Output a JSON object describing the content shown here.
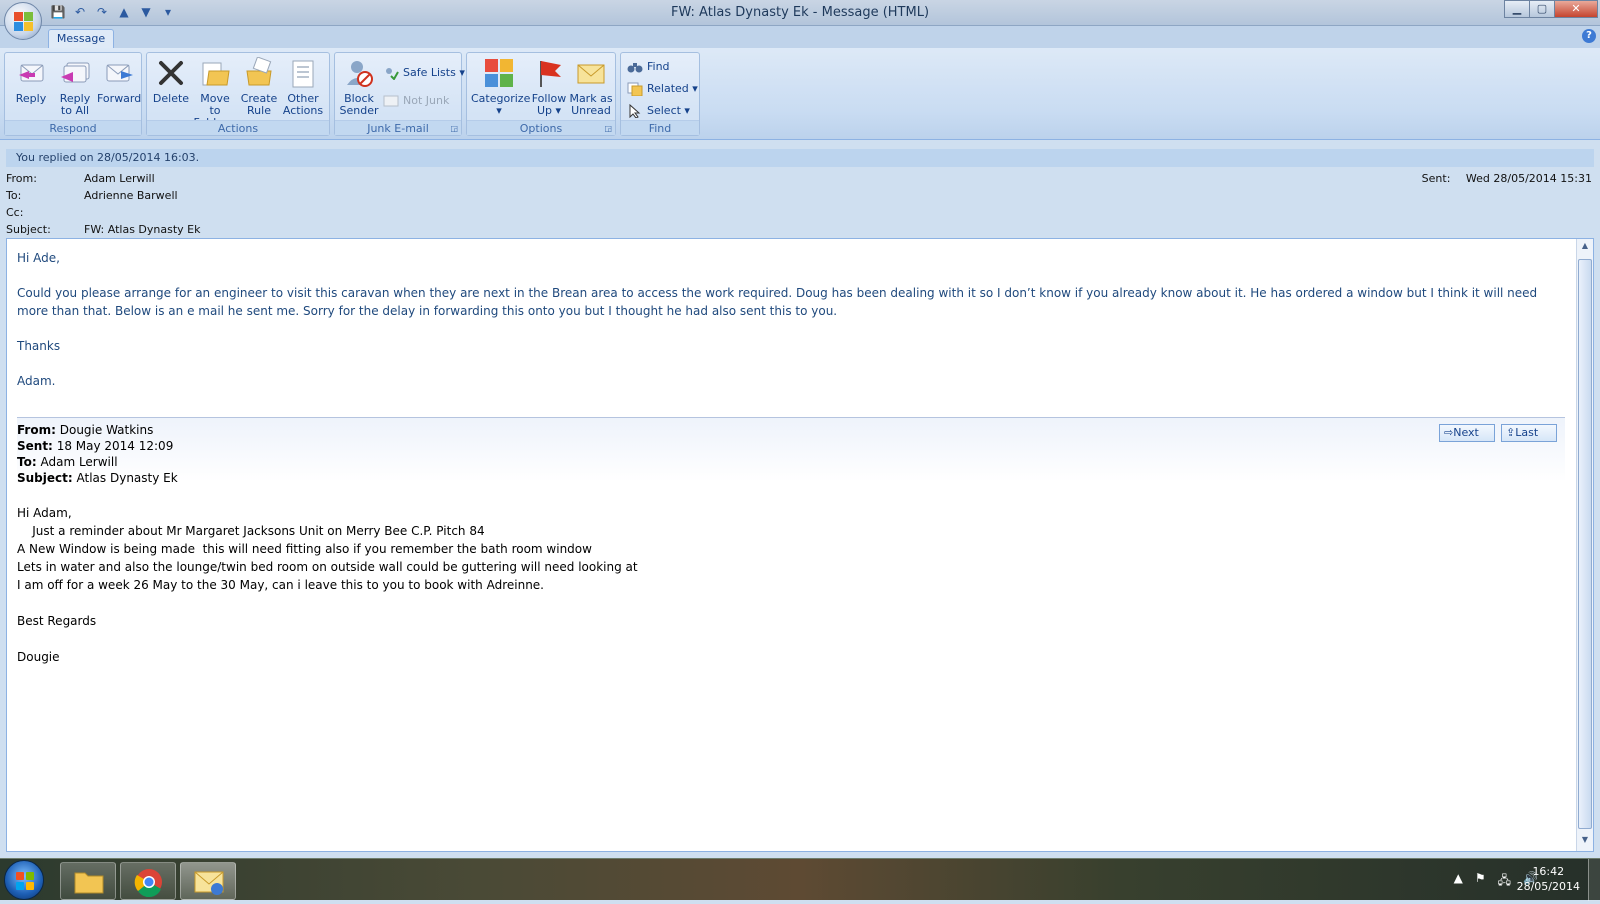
{
  "window": {
    "title": "FW: Atlas Dynasty Ek - Message (HTML)",
    "minimize": "▁",
    "maximize": "▢",
    "close": "✕"
  },
  "ribbon": {
    "tab_label": "Message",
    "groups": {
      "respond": {
        "label": "Respond",
        "reply": "Reply",
        "reply_all_1": "Reply",
        "reply_all_2": "to All",
        "forward": "Forward"
      },
      "actions": {
        "label": "Actions",
        "delete": "Delete",
        "move_1": "Move to",
        "move_2": "Folder ▾",
        "rule_1": "Create",
        "rule_2": "Rule",
        "other_1": "Other",
        "other_2": "Actions ▾"
      },
      "junk": {
        "label": "Junk E-mail",
        "block_1": "Block",
        "block_2": "Sender",
        "safe_lists": "Safe Lists ▾",
        "not_junk": "Not Junk"
      },
      "options": {
        "label": "Options",
        "categorize": "Categorize",
        "categorize_arrow": "▾",
        "follow_1": "Follow",
        "follow_2": "Up ▾",
        "mark_1": "Mark as",
        "mark_2": "Unread"
      },
      "find": {
        "label": "Find",
        "find": "Find",
        "related": "Related ▾",
        "select": "Select ▾"
      }
    }
  },
  "message": {
    "info_bar": "You replied on 28/05/2014 16:03.",
    "from_label": "From:",
    "from": "Adam Lerwill",
    "to_label": "To:",
    "to": "Adrienne Barwell",
    "cc_label": "Cc:",
    "cc": "",
    "subject_label": "Subject:",
    "subject": "FW: Atlas Dynasty Ek",
    "sent_label": "Sent:",
    "sent": "Wed 28/05/2014 15:31"
  },
  "body": {
    "greeting": "Hi Ade,",
    "paragraph": "Could you please arrange for an engineer to visit this caravan when they are next in the Brean area to access the work required.  Doug has been dealing with it so I don’t know if you already know about it.  He has ordered a window but I think it will need more than that.  Below is an e mail he sent me.  Sorry for the delay in forwarding this onto you but I thought he had also sent this to you.",
    "thanks": "Thanks",
    "signoff": "Adam."
  },
  "forwarded": {
    "from_label": "From:",
    "from": "Dougie Watkins",
    "sent_label": "Sent:",
    "sent": "18 May 2014 12:09",
    "to_label": "To:",
    "to": "Adam Lerwill",
    "subject_label": "Subject:",
    "subject": "Atlas Dynasty Ek",
    "next": "Next",
    "last": "Last",
    "lines": [
      "Hi Adam,",
      "    Just a reminder about Mr Margaret Jacksons Unit on Merry Bee C.P. Pitch 84",
      "A New Window is being made  this will need fitting also if you remember the bath room window",
      "Lets in water and also the lounge/twin bed room on outside wall could be guttering will need looking at",
      "I am off for a week 26 May to the 30 May, can i leave this to you to book with Adreinne.",
      "Best Regards",
      "Dougie"
    ]
  },
  "taskbar": {
    "time": "16:42",
    "date": "28/05/2014"
  },
  "icons": {
    "office": "office-button-icon",
    "start": "windows-start-icon",
    "explorer": "folder-icon",
    "chrome": "chrome-icon",
    "outlook": "outlook-icon"
  },
  "colors": {
    "ribbon_text": "#15428b",
    "body_text": "#1f497d",
    "accent": "#8db2e3"
  }
}
